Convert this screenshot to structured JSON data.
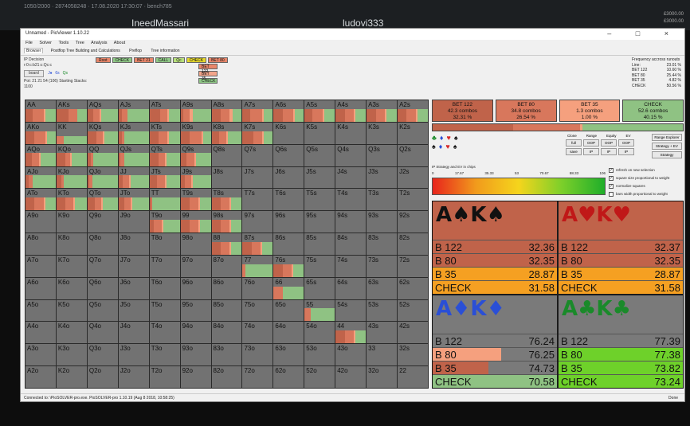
{
  "stream": {
    "info": "1050/2000 · 2874058248 · 17.08.2020 17:30:07 · bench785",
    "player_left": "IneedMassari",
    "player_right": "ludovi333",
    "right_lines": [
      "£3000.00",
      "£3000.00"
    ]
  },
  "window": {
    "title": "Unnamed - PioViewer 1.10.22",
    "controls": "– □ ×"
  },
  "menu": [
    "File",
    "Solver",
    "Tools",
    "Tree",
    "Analysis",
    "About"
  ],
  "tabs": [
    "Browser",
    "Postflop Tree Building and Calculations",
    "Preflop",
    "Tree information"
  ],
  "info": {
    "decision": "IP Decision",
    "line": "r:0:c:b21:c:Qc:c",
    "board_label": "board",
    "board_cards": [
      {
        "t": "J♠",
        "c": "suit-blue"
      },
      {
        "t": "6s",
        "c": "suit-blue"
      },
      {
        "t": "Qs",
        "c": "suit-green"
      }
    ],
    "pot": "Pot: 21 21 54 (106) Starting Stacks: 1100"
  },
  "action_buttons": [
    {
      "label": "Root",
      "color": "#e8866a"
    },
    {
      "label": "CHECK",
      "color": "#90c987"
    },
    {
      "label": "BET 21",
      "color": "#e8866a"
    },
    {
      "label": "CALL",
      "color": "#90c987"
    },
    {
      "label": "Qc",
      "color": "#b8e07c"
    },
    {
      "label": "CHECK",
      "color": "#e6d82c"
    },
    {
      "label": "BET 80",
      "color": "#e8866a"
    }
  ],
  "sub_buttons": [
    {
      "label": "BET 122",
      "color": "#e8866a"
    },
    {
      "label": "BET 35",
      "color": "#f3a58a"
    },
    {
      "label": "CHECK",
      "color": "#90c987"
    }
  ],
  "freq": {
    "title": "Frequency accross runouts",
    "rows": [
      [
        "Line:",
        "23.01 %"
      ],
      [
        "BET 122",
        "10.60 %"
      ],
      [
        "BET 80",
        "25.44 %"
      ],
      [
        "BET 35",
        "4.82 %"
      ],
      [
        "CHECK",
        "50.56 %"
      ]
    ]
  },
  "grid": {
    "ranks": [
      "A",
      "K",
      "Q",
      "J",
      "T",
      "9",
      "8",
      "7",
      "6",
      "5",
      "4",
      "3",
      "2"
    ],
    "colors": {
      "bet122": "#c0634a",
      "bet80": "#d8775c",
      "bet35": "#f5a07e",
      "check": "#8fc283",
      "empty": "#727272"
    },
    "cells": {
      "AA": [
        0.25,
        0.35,
        0.05,
        0.35
      ],
      "AKs": [
        0.4,
        0.3,
        0,
        0.3
      ],
      "AQs": [
        0.2,
        0.2,
        0.05,
        0.55
      ],
      "AJs": [
        0.1,
        0.2,
        0,
        0.7
      ],
      "ATs": [
        0.35,
        0.25,
        0.05,
        0.35
      ],
      "A9s": [
        0.1,
        0.2,
        0.1,
        0.6
      ],
      "A8s": [
        0.3,
        0.3,
        0.1,
        0.3
      ],
      "A7s": [
        0.25,
        0.4,
        0.05,
        0.3
      ],
      "A6s": [
        0.3,
        0.35,
        0.05,
        0.3
      ],
      "A5s": [
        0.25,
        0.35,
        0.05,
        0.35
      ],
      "A4s": [
        0.3,
        0.3,
        0.05,
        0.35
      ],
      "A3s": [
        0.3,
        0.3,
        0.05,
        0.35
      ],
      "A2s": [
        0.3,
        0.3,
        0.05,
        0.35
      ],
      "AKo": [
        0.3,
        0.35,
        0.05,
        0.3
      ],
      "KK": [
        0,
        0.15,
        0,
        0.45
      ],
      "KQs": [
        0.3,
        0.2,
        0.05,
        0.45
      ],
      "KJs": [
        0.1,
        0.1,
        0,
        0.8
      ],
      "KTs": [
        0.3,
        0.3,
        0.05,
        0.35
      ],
      "K9s": [
        0.3,
        0.4,
        0.05,
        0.25
      ],
      "K8s": [
        0.25,
        0.25,
        0.05,
        0.45
      ],
      "K7s": [
        0.35,
        0.3,
        0.05,
        0.3
      ],
      "AQo": [
        0.2,
        0.25,
        0.05,
        0.5
      ],
      "KQo": [
        0.3,
        0.15,
        0.05,
        0.5
      ],
      "QQ": [
        0.1,
        0.1,
        0,
        0.8
      ],
      "QJs": [
        0.05,
        0.15,
        0,
        0.8
      ],
      "QTs": [
        0.3,
        0.2,
        0.05,
        0.45
      ],
      "Q9s": [
        0.2,
        0.25,
        0.05,
        0.5
      ],
      "AJo": [
        0.1,
        0.15,
        0,
        0.75
      ],
      "KJo": [
        0.15,
        0.1,
        0,
        0.75
      ],
      "QJo": [
        0.05,
        0.1,
        0,
        0.85
      ],
      "JJ": [
        0.15,
        0.2,
        0.05,
        0.6
      ],
      "JTs": [
        0.25,
        0.25,
        0.05,
        0.45
      ],
      "J9s": [
        0.15,
        0.2,
        0.05,
        0.6
      ],
      "ATo": [
        0.3,
        0.3,
        0.05,
        0.35
      ],
      "KTo": [
        0.3,
        0.25,
        0.05,
        0.4
      ],
      "QTo": [
        0.25,
        0.2,
        0.05,
        0.5
      ],
      "JTo": [
        0.2,
        0.2,
        0.05,
        0.55
      ],
      "TT": [
        0.05,
        0.05,
        0,
        0.9
      ],
      "T9s": [
        0.3,
        0.3,
        0.05,
        0.35
      ],
      "T8s": [
        0.3,
        0.3,
        0.05,
        0.35
      ],
      "T9o": [
        0.15,
        0.25,
        0.05,
        0.55
      ],
      "99": [
        0.3,
        0.3,
        0.05,
        0.35
      ],
      "98s": [
        0.3,
        0.3,
        0.05,
        0.35
      ],
      "88": [
        0.3,
        0.3,
        0.05,
        0.35
      ],
      "87s": [
        0.3,
        0.3,
        0.05,
        0.35
      ],
      "77": [
        0,
        0.1,
        0,
        0.9
      ],
      "76s": [
        0.3,
        0.3,
        0.05,
        0.35
      ],
      "66": [
        0,
        0.3,
        0,
        0.7
      ],
      "55": [
        0,
        0.2,
        0,
        0.8
      ],
      "44": [
        0.3,
        0.3,
        0.05,
        0.35
      ]
    }
  },
  "summary": [
    {
      "name": "BET 122",
      "combos": "42.3 combos",
      "pct": "32.31 %",
      "color": "#c0634a"
    },
    {
      "name": "BET 80",
      "combos": "34.8 combos",
      "pct": "26.54 %",
      "color": "#d8775c"
    },
    {
      "name": "BET 35",
      "combos": "1.3 combos",
      "pct": "1.00 %",
      "color": "#f5a07e"
    },
    {
      "name": "CHECK",
      "combos": "52.6 combos",
      "pct": "40.15 %",
      "color": "#8fc283"
    }
  ],
  "suit_filter": {
    "row1": [
      {
        "t": "♣",
        "c": "#1a8a2a"
      },
      {
        "t": "♦",
        "c": "#2a4fd6"
      },
      {
        "t": "♥",
        "c": "#d62a2a"
      },
      {
        "t": "♠",
        "c": "#111"
      }
    ],
    "row2": [
      {
        "t": "♠",
        "c": "#111"
      },
      {
        "t": "♦",
        "c": "#2a4fd6"
      },
      {
        "t": "♥",
        "c": "#d62a2a"
      },
      {
        "t": "♠",
        "c": "#111"
      }
    ]
  },
  "controls": {
    "headers": [
      "Clone",
      "Range",
      "Equity",
      "EV"
    ],
    "row1": [
      "full",
      "OOP",
      "OOP",
      "OOP"
    ],
    "row2": [
      "save",
      "IP",
      "IP",
      "IP"
    ],
    "range_explorer": "Range Explorer",
    "strategy_ev": "Strategy + EV",
    "strategy": "Strategy"
  },
  "gradient": {
    "label": "IP Strategy and EV in chips",
    "ticks": [
      "0",
      "17.67",
      "35.33",
      "53",
      "70.67",
      "88.33",
      "106"
    ]
  },
  "options": [
    {
      "label": "refresh on new selection",
      "checked": true
    },
    {
      "label": "square size proportional to weight",
      "checked": true
    },
    {
      "label": "normalize squares",
      "checked": true
    },
    {
      "label": "bars width proportional to weight",
      "checked": false
    }
  ],
  "combos": [
    {
      "title": "A♠K♠",
      "titlecolor": "#111",
      "bg": "#c0634a",
      "rows": [
        {
          "name": "B 122",
          "ev": "32.36",
          "color": "#c0634a",
          "fill": 1
        },
        {
          "name": "B 80",
          "ev": "32.35",
          "color": "#c0634a",
          "fill": 1
        },
        {
          "name": "B 35",
          "ev": "28.87",
          "color": "#f5a022",
          "fill": 1
        },
        {
          "name": "CHECK",
          "ev": "31.58",
          "color": "#f5a022",
          "fill": 1
        }
      ]
    },
    {
      "title": "A♥K♥",
      "titlecolor": "#c01818",
      "bg": "#c0634a",
      "rows": [
        {
          "name": "B 122",
          "ev": "32.37",
          "color": "#c0634a",
          "fill": 1
        },
        {
          "name": "B 80",
          "ev": "32.35",
          "color": "#c0634a",
          "fill": 1
        },
        {
          "name": "B 35",
          "ev": "28.87",
          "color": "#f5a022",
          "fill": 1
        },
        {
          "name": "CHECK",
          "ev": "31.58",
          "color": "#f5a022",
          "fill": 1
        }
      ]
    },
    {
      "title": "A♦K♦",
      "titlecolor": "#2a4fd6",
      "bg": "#7a7a7a",
      "rows": [
        {
          "name": "B 122",
          "ev": "76.24",
          "color": "#7a7a7a",
          "fill": 0.55
        },
        {
          "name": "B 80",
          "ev": "76.25",
          "color": "#f5a07e",
          "fill": 0.55
        },
        {
          "name": "B 35",
          "ev": "74.73",
          "color": "#c0634a",
          "fill": 0.45
        },
        {
          "name": "CHECK",
          "ev": "70.58",
          "color": "#8fc283",
          "fill": 1
        }
      ]
    },
    {
      "title": "A♣K♣",
      "titlecolor": "#1a8a2a",
      "bg": "#7a7a7a",
      "rows": [
        {
          "name": "B 122",
          "ev": "77.39",
          "color": "#7a7a7a",
          "fill": 1
        },
        {
          "name": "B 80",
          "ev": "77.38",
          "color": "#6ed12a",
          "fill": 1
        },
        {
          "name": "B 35",
          "ev": "73.82",
          "color": "#6ed12a",
          "fill": 1
        },
        {
          "name": "CHECK",
          "ev": "73.24",
          "color": "#6ed12a",
          "fill": 1
        }
      ]
    }
  ],
  "status": {
    "text": "Connected to: \\PioSOLVER-pro.exe. PioSOLVER-pro 1.10.19 (Aug 8 2018, 10:58:25)",
    "right": "Done"
  }
}
